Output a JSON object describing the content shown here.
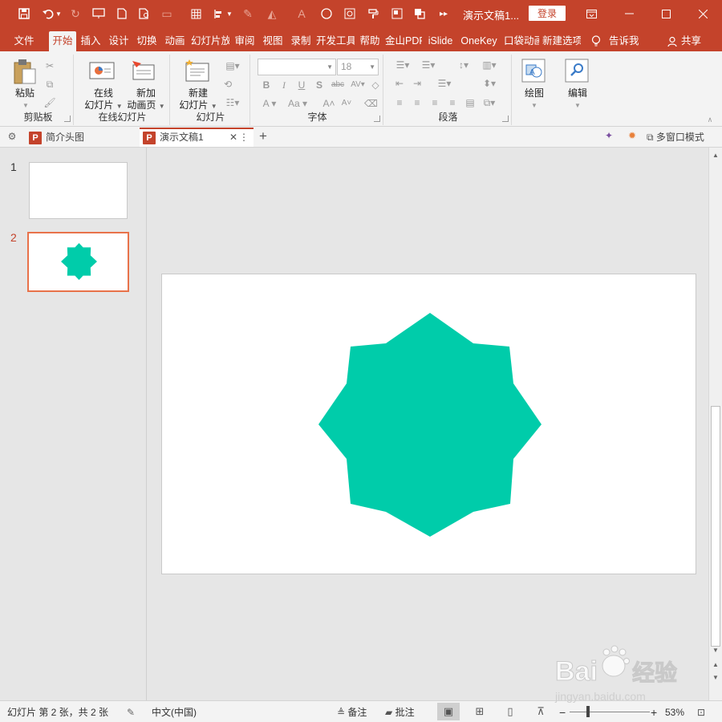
{
  "titlebar": {
    "doc_title": "演示文稿1...",
    "login_label": "登录"
  },
  "tabs": [
    {
      "label": "文件",
      "active": false
    },
    {
      "label": "开始",
      "active": true
    },
    {
      "label": "插入",
      "active": false
    },
    {
      "label": "设计",
      "active": false
    },
    {
      "label": "切换",
      "active": false
    },
    {
      "label": "动画",
      "active": false
    },
    {
      "label": "幻灯片放",
      "active": false
    },
    {
      "label": "审阅",
      "active": false
    },
    {
      "label": "视图",
      "active": false
    },
    {
      "label": "录制",
      "active": false
    },
    {
      "label": "开发工具",
      "active": false
    },
    {
      "label": "帮助",
      "active": false
    },
    {
      "label": "金山PDF",
      "active": false
    },
    {
      "label": "iSlide",
      "active": false
    },
    {
      "label": "OneKey",
      "active": false
    },
    {
      "label": "口袋动画",
      "active": false
    },
    {
      "label": "新建选项",
      "active": false
    }
  ],
  "tell_me": "告诉我",
  "share": "共享",
  "ribbon": {
    "clipboard": {
      "paste": "粘贴",
      "group": "剪贴板"
    },
    "online_slides": {
      "online_line1": "在线",
      "online_line2": "幻灯片",
      "new_anim_line1": "新加",
      "new_anim_line2": "动画页",
      "group": "在线幻灯片"
    },
    "slides": {
      "new_line1": "新建",
      "new_line2": "幻灯片",
      "group": "幻灯片"
    },
    "font": {
      "name_value": "",
      "size_value": "18",
      "group": "字体"
    },
    "paragraph": {
      "group": "段落"
    },
    "drawing": {
      "label": "绘图"
    },
    "editing": {
      "label": "编辑"
    }
  },
  "doctabs": {
    "tab1": "简介头图",
    "tab2": "演示文稿1",
    "multiwindow": "多窗口模式"
  },
  "thumbnails": [
    {
      "number": "1",
      "selected": false,
      "has_star": false
    },
    {
      "number": "2",
      "selected": true,
      "has_star": true
    }
  ],
  "slide": {
    "shape": "8-point-star",
    "shape_color": "#00CCAA"
  },
  "statusbar": {
    "slide_info": "幻灯片 第 2 张，共 2 张",
    "language": "中文(中国)",
    "notes": "备注",
    "comments": "批注",
    "zoom": "53%"
  },
  "watermark": {
    "text": "Bai经验",
    "url": "jingyan.baidu.com"
  },
  "colors": {
    "accent": "#C4432B",
    "selected_border": "#E8724A"
  }
}
